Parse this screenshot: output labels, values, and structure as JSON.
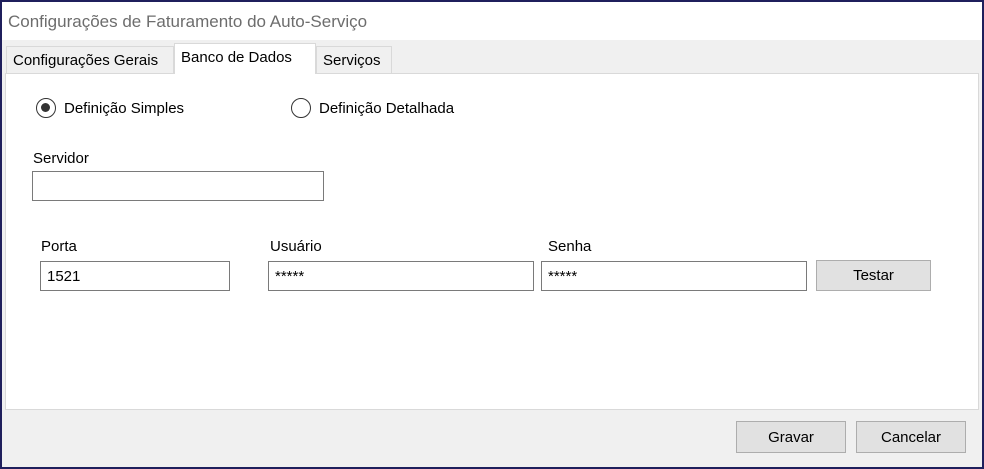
{
  "window": {
    "title": "Configurações de Faturamento do Auto-Serviço"
  },
  "tabs": [
    {
      "label": "Configurações Gerais",
      "active": false
    },
    {
      "label": "Banco de Dados",
      "active": true
    },
    {
      "label": "Serviços",
      "active": false
    }
  ],
  "definition": {
    "simple_label": "Definição Simples",
    "detailed_label": "Definição Detalhada",
    "selected": "simple"
  },
  "fields": {
    "servidor_label": "Servidor",
    "servidor_value": "",
    "porta_label": "Porta",
    "porta_value": "1521",
    "usuario_label": "Usuário",
    "usuario_value": "*****",
    "senha_label": "Senha",
    "senha_value": "*****"
  },
  "buttons": {
    "test_label": "Testar",
    "save_label": "Gravar",
    "cancel_label": "Cancelar"
  }
}
